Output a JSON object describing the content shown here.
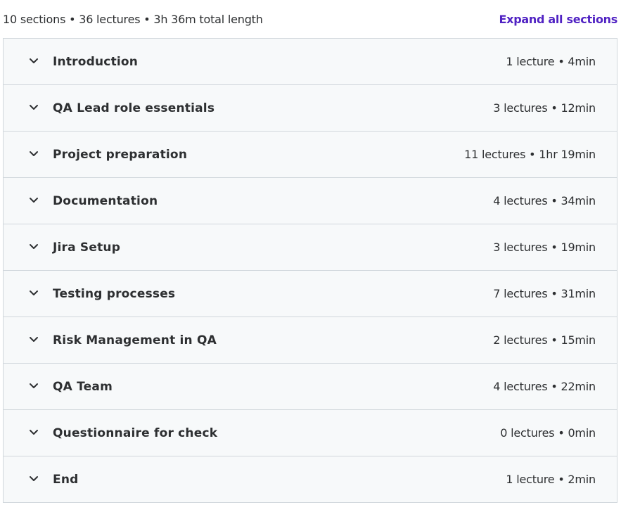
{
  "summary": {
    "text": "10 sections • 36 lectures • 3h 36m total length",
    "expand_label": "Expand all sections"
  },
  "colors": {
    "accent": "#5022c3",
    "row_background": "#f7f9fa",
    "border": "#d1d7dc",
    "text": "#2d2f31"
  },
  "sections": [
    {
      "title": "Introduction",
      "meta": "1 lecture • 4min",
      "icon": "chevron-down-icon"
    },
    {
      "title": "QA Lead role essentials",
      "meta": "3 lectures • 12min",
      "icon": "chevron-down-icon"
    },
    {
      "title": "Project preparation",
      "meta": "11 lectures • 1hr 19min",
      "icon": "chevron-down-icon"
    },
    {
      "title": "Documentation",
      "meta": "4 lectures • 34min",
      "icon": "chevron-down-icon"
    },
    {
      "title": "Jira Setup",
      "meta": "3 lectures • 19min",
      "icon": "chevron-down-icon"
    },
    {
      "title": "Testing processes",
      "meta": "7 lectures • 31min",
      "icon": "chevron-down-icon"
    },
    {
      "title": "Risk Management in QA",
      "meta": "2 lectures • 15min",
      "icon": "chevron-down-icon"
    },
    {
      "title": "QA Team",
      "meta": "4 lectures • 22min",
      "icon": "chevron-down-icon"
    },
    {
      "title": "Questionnaire for check",
      "meta": "0 lectures • 0min",
      "icon": "chevron-down-icon"
    },
    {
      "title": "End",
      "meta": "1 lecture • 2min",
      "icon": "chevron-down-icon"
    }
  ]
}
